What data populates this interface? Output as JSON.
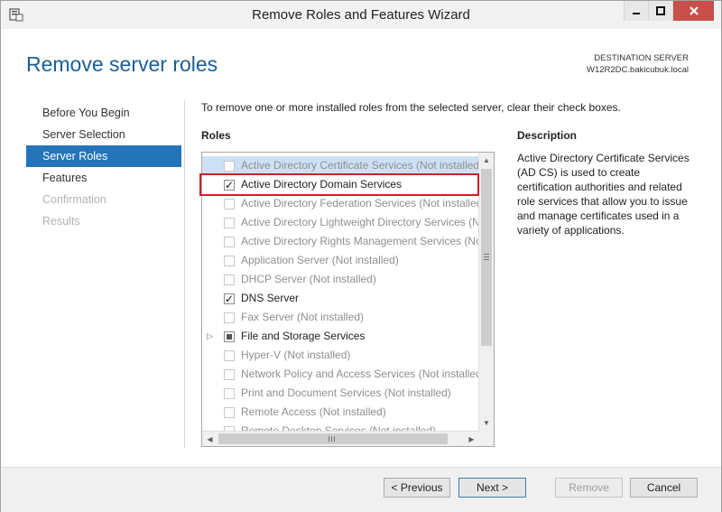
{
  "window": {
    "title": "Remove Roles and Features Wizard",
    "controls": [
      "minimize-icon",
      "maximize-icon",
      "close-icon"
    ]
  },
  "header": {
    "title": "Remove server roles",
    "destination_label": "DESTINATION SERVER",
    "destination_server": "W12R2DC.bakicubuk.local"
  },
  "nav": {
    "items": [
      {
        "label": "Before You Begin",
        "state": "normal"
      },
      {
        "label": "Server Selection",
        "state": "normal"
      },
      {
        "label": "Server Roles",
        "state": "active"
      },
      {
        "label": "Features",
        "state": "normal"
      },
      {
        "label": "Confirmation",
        "state": "disabled"
      },
      {
        "label": "Results",
        "state": "disabled"
      }
    ]
  },
  "main": {
    "intro": "To remove one or more installed roles from the selected server, clear their check boxes.",
    "roles_label": "Roles",
    "description_label": "Description",
    "description_text": "Active Directory Certificate Services (AD CS) is used to create certification authorities and related role services that allow you to issue and manage certificates used in a variety of applications.",
    "roles": [
      {
        "label": "Active Directory Certificate Services (Not installed)",
        "checked": false,
        "enabled": false,
        "selected": true
      },
      {
        "label": "Active Directory Domain Services",
        "checked": true,
        "enabled": true,
        "selected": false
      },
      {
        "label": "Active Directory Federation Services (Not installed)",
        "checked": false,
        "enabled": false,
        "selected": false
      },
      {
        "label": "Active Directory Lightweight Directory Services (No",
        "checked": false,
        "enabled": false,
        "selected": false
      },
      {
        "label": "Active Directory Rights Management Services (No",
        "checked": false,
        "enabled": false,
        "selected": false
      },
      {
        "label": "Application Server (Not installed)",
        "checked": false,
        "enabled": false,
        "selected": false
      },
      {
        "label": "DHCP Server (Not installed)",
        "checked": false,
        "enabled": false,
        "selected": false
      },
      {
        "label": "DNS Server",
        "checked": true,
        "enabled": true,
        "selected": false
      },
      {
        "label": "Fax Server (Not installed)",
        "checked": false,
        "enabled": false,
        "selected": false
      },
      {
        "label": "File and Storage Services",
        "checked": "partial",
        "enabled": true,
        "selected": false,
        "expandable": true
      },
      {
        "label": "Hyper-V (Not installed)",
        "checked": false,
        "enabled": false,
        "selected": false
      },
      {
        "label": "Network Policy and Access Services (Not installed)",
        "checked": false,
        "enabled": false,
        "selected": false
      },
      {
        "label": "Print and Document Services (Not installed)",
        "checked": false,
        "enabled": false,
        "selected": false
      },
      {
        "label": "Remote Access (Not installed)",
        "checked": false,
        "enabled": false,
        "selected": false
      },
      {
        "label": "Remote Desktop Services (Not installed)",
        "checked": false,
        "enabled": false,
        "selected": false
      }
    ]
  },
  "footer": {
    "previous_label": "< Previous",
    "next_label": "Next >",
    "remove_label": "Remove",
    "cancel_label": "Cancel"
  },
  "colors": {
    "accent": "#2474b9",
    "title": "#1c5f94",
    "highlight": "#d11f25",
    "close_button": "#c7504a"
  }
}
